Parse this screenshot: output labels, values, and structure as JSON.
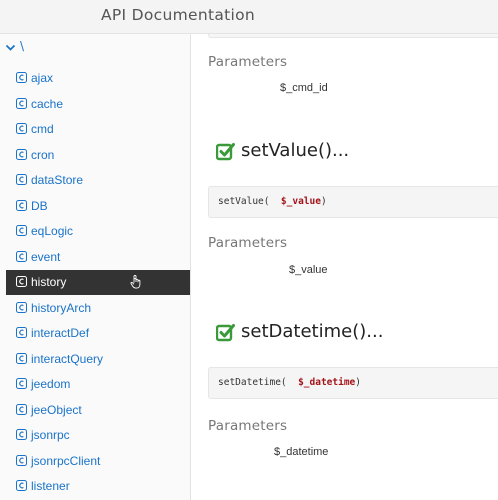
{
  "header": {
    "title": "API Documentation"
  },
  "sidebar": {
    "root_label": "\\",
    "items": [
      {
        "label": "ajax"
      },
      {
        "label": "cache"
      },
      {
        "label": "cmd"
      },
      {
        "label": "cron"
      },
      {
        "label": "dataStore"
      },
      {
        "label": "DB"
      },
      {
        "label": "eqLogic"
      },
      {
        "label": "event"
      },
      {
        "label": "history"
      },
      {
        "label": "historyArch"
      },
      {
        "label": "interactDef"
      },
      {
        "label": "interactQuery"
      },
      {
        "label": "jeedom"
      },
      {
        "label": "jeeObject"
      },
      {
        "label": "jsonrpc"
      },
      {
        "label": "jsonrpcClient"
      },
      {
        "label": "listener"
      }
    ],
    "active_item": "history"
  },
  "main": {
    "sections": [
      {
        "params_heading": "Parameters",
        "param": "$_cmd_id"
      },
      {
        "method_title": "setValue()...",
        "signature_prefix": "setValue(  ",
        "signature_arg": "$_value",
        "signature_suffix": ")",
        "params_heading": "Parameters",
        "param": "$_value"
      },
      {
        "method_title": "setDatetime()...",
        "signature_prefix": "setDatetime(  ",
        "signature_arg": "$_datetime",
        "signature_suffix": ")",
        "params_heading": "Parameters",
        "param": "$_datetime"
      }
    ]
  },
  "colors": {
    "link": "#1a73c8",
    "active_bg": "#333333",
    "check": "#3a9a3a",
    "arg": "#a3151b"
  }
}
